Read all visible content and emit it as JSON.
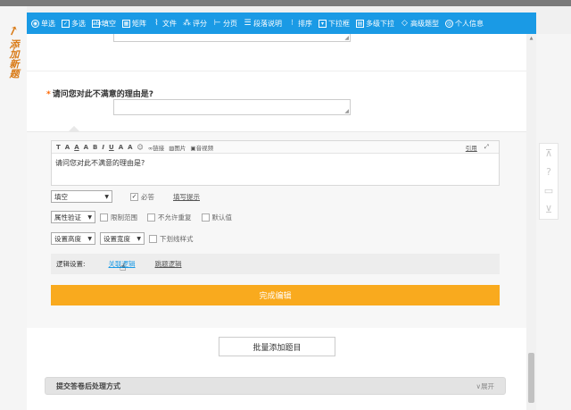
{
  "side_label": "添加新题",
  "toolbar": [
    {
      "icon": "radio-icon",
      "glyph": "◉",
      "label": "单选"
    },
    {
      "icon": "checkbox-icon",
      "glyph": "✓",
      "label": "多选"
    },
    {
      "icon": "fill-blank-icon",
      "glyph": "abc",
      "label": "填空"
    },
    {
      "icon": "matrix-icon",
      "glyph": "▦",
      "label": "矩阵"
    },
    {
      "icon": "paperclip-icon",
      "glyph": "⌇",
      "label": "文件"
    },
    {
      "icon": "rating-icon",
      "glyph": "⁂",
      "label": "评分"
    },
    {
      "icon": "page-break-icon",
      "glyph": "⊢",
      "label": "分页"
    },
    {
      "icon": "paragraph-icon",
      "glyph": "☰",
      "label": "段落说明"
    },
    {
      "icon": "sort-icon",
      "glyph": "⁝",
      "label": "排序"
    },
    {
      "icon": "dropdown-icon",
      "glyph": "▾",
      "label": "下拉框"
    },
    {
      "icon": "multi-dropdown-icon",
      "glyph": "▤",
      "label": "多级下拉"
    },
    {
      "icon": "advanced-icon",
      "glyph": "◇",
      "label": "高级题型"
    },
    {
      "icon": "person-icon",
      "glyph": "◎",
      "label": "个人信息"
    }
  ],
  "question": {
    "required_mark": "*",
    "title": "请问您对此不满意的理由是?"
  },
  "editor": {
    "tools": [
      "T",
      "A",
      "A",
      "A",
      "B",
      "I",
      "U",
      "A",
      "A",
      "☺"
    ],
    "link_label": "链接",
    "image_label": "图片",
    "audio_label": "音视频",
    "quote_label": "引用",
    "content": "请问您对此不满意的理由是?"
  },
  "controls": {
    "type_select": "填空",
    "required_label": "必答",
    "required_checked": true,
    "fill_hint_link": "填写提示",
    "validation_select": "属性验证",
    "limit_range_label": "限制范围",
    "no_repeat_label": "不允许重复",
    "default_label": "默认值",
    "height_select": "设置高度",
    "width_select": "设置宽度",
    "underline_label": "下划线样式"
  },
  "logic": {
    "label": "逻辑设置:",
    "related_link": "关联逻辑",
    "jump_link": "跳题逻辑"
  },
  "finish_button": "完成编辑",
  "batch_button": "批量添加题目",
  "submit_section": {
    "title": "提交答卷后处理方式",
    "expand": "展开"
  }
}
